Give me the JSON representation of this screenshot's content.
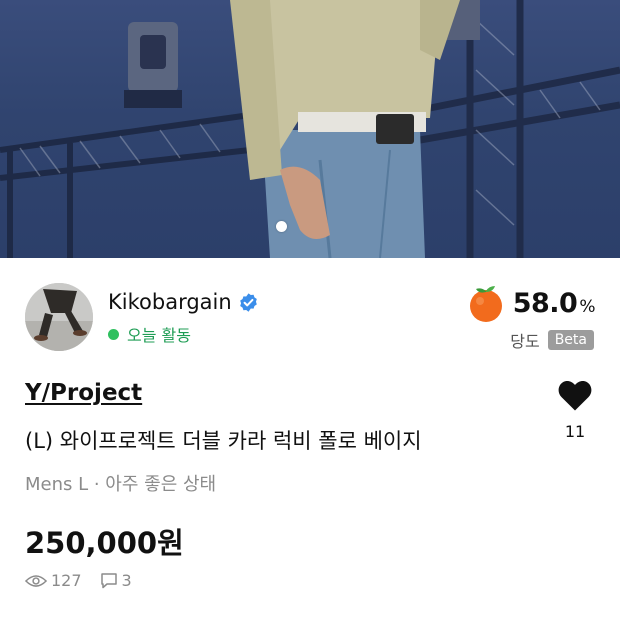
{
  "hero": {
    "indicator_count": 1
  },
  "seller": {
    "name": "Kikobargain",
    "verified": true,
    "activity": "오늘 활동"
  },
  "temperature": {
    "value": "58.0",
    "unit": "%",
    "label": "당도",
    "badge": "Beta"
  },
  "product": {
    "brand": "Y/Project",
    "title": "(L) 와이프로젝트 더블 카라 럭비 폴로 베이지",
    "meta": "Mens L · 아주 좋은 상태",
    "price": "250,000원"
  },
  "like": {
    "count": "11"
  },
  "stats": {
    "views": "127",
    "comments": "3"
  },
  "colors": {
    "active_green": "#2fc05f",
    "verified_blue": "#3b8eea",
    "temp_orange": "#f26b1d",
    "secondary_text": "#8b8b8b"
  }
}
